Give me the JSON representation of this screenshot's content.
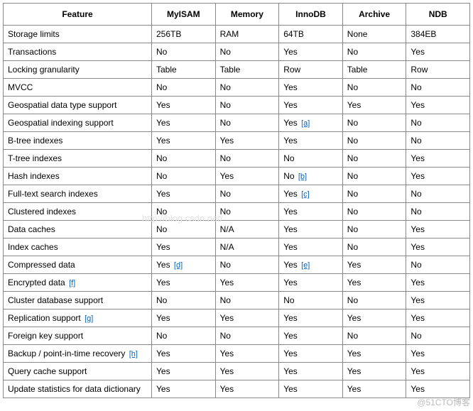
{
  "chart_data": {
    "type": "table",
    "title": "",
    "columns": [
      "Feature",
      "MyISAM",
      "Memory",
      "InnoDB",
      "Archive",
      "NDB"
    ],
    "rows": [
      {
        "feature": "Storage limits",
        "note": null,
        "values": [
          "256TB",
          "RAM",
          "64TB",
          "None",
          "384EB"
        ],
        "cell_notes": [
          null,
          null,
          null,
          null,
          null
        ]
      },
      {
        "feature": "Transactions",
        "note": null,
        "values": [
          "No",
          "No",
          "Yes",
          "No",
          "Yes"
        ],
        "cell_notes": [
          null,
          null,
          null,
          null,
          null
        ]
      },
      {
        "feature": "Locking granularity",
        "note": null,
        "values": [
          "Table",
          "Table",
          "Row",
          "Table",
          "Row"
        ],
        "cell_notes": [
          null,
          null,
          null,
          null,
          null
        ]
      },
      {
        "feature": "MVCC",
        "note": null,
        "values": [
          "No",
          "No",
          "Yes",
          "No",
          "No"
        ],
        "cell_notes": [
          null,
          null,
          null,
          null,
          null
        ]
      },
      {
        "feature": "Geospatial data type support",
        "note": null,
        "values": [
          "Yes",
          "No",
          "Yes",
          "Yes",
          "Yes"
        ],
        "cell_notes": [
          null,
          null,
          null,
          null,
          null
        ]
      },
      {
        "feature": "Geospatial indexing support",
        "note": null,
        "values": [
          "Yes",
          "No",
          "Yes",
          "No",
          "No"
        ],
        "cell_notes": [
          null,
          null,
          "[a]",
          null,
          null
        ]
      },
      {
        "feature": "B-tree indexes",
        "note": null,
        "values": [
          "Yes",
          "Yes",
          "Yes",
          "No",
          "No"
        ],
        "cell_notes": [
          null,
          null,
          null,
          null,
          null
        ]
      },
      {
        "feature": "T-tree indexes",
        "note": null,
        "values": [
          "No",
          "No",
          "No",
          "No",
          "Yes"
        ],
        "cell_notes": [
          null,
          null,
          null,
          null,
          null
        ]
      },
      {
        "feature": "Hash indexes",
        "note": null,
        "values": [
          "No",
          "Yes",
          "No",
          "No",
          "Yes"
        ],
        "cell_notes": [
          null,
          null,
          "[b]",
          null,
          null
        ]
      },
      {
        "feature": "Full-text search indexes",
        "note": null,
        "values": [
          "Yes",
          "No",
          "Yes",
          "No",
          "No"
        ],
        "cell_notes": [
          null,
          null,
          "[c]",
          null,
          null
        ]
      },
      {
        "feature": "Clustered indexes",
        "note": null,
        "values": [
          "No",
          "No",
          "Yes",
          "No",
          "No"
        ],
        "cell_notes": [
          null,
          null,
          null,
          null,
          null
        ]
      },
      {
        "feature": "Data caches",
        "note": null,
        "values": [
          "No",
          "N/A",
          "Yes",
          "No",
          "Yes"
        ],
        "cell_notes": [
          null,
          null,
          null,
          null,
          null
        ]
      },
      {
        "feature": "Index caches",
        "note": null,
        "values": [
          "Yes",
          "N/A",
          "Yes",
          "No",
          "Yes"
        ],
        "cell_notes": [
          null,
          null,
          null,
          null,
          null
        ]
      },
      {
        "feature": "Compressed data",
        "note": null,
        "values": [
          "Yes",
          "No",
          "Yes",
          "Yes",
          "No"
        ],
        "cell_notes": [
          "[d]",
          null,
          "[e]",
          null,
          null
        ]
      },
      {
        "feature": "Encrypted data",
        "note": "[f]",
        "values": [
          "Yes",
          "Yes",
          "Yes",
          "Yes",
          "Yes"
        ],
        "cell_notes": [
          null,
          null,
          null,
          null,
          null
        ]
      },
      {
        "feature": "Cluster database support",
        "note": null,
        "values": [
          "No",
          "No",
          "No",
          "No",
          "Yes"
        ],
        "cell_notes": [
          null,
          null,
          null,
          null,
          null
        ]
      },
      {
        "feature": "Replication support",
        "note": "[g]",
        "values": [
          "Yes",
          "Yes",
          "Yes",
          "Yes",
          "Yes"
        ],
        "cell_notes": [
          null,
          null,
          null,
          null,
          null
        ]
      },
      {
        "feature": "Foreign key support",
        "note": null,
        "values": [
          "No",
          "No",
          "Yes",
          "No",
          "No"
        ],
        "cell_notes": [
          null,
          null,
          null,
          null,
          null
        ]
      },
      {
        "feature": "Backup / point-in-time recovery",
        "note": "[h]",
        "values": [
          "Yes",
          "Yes",
          "Yes",
          "Yes",
          "Yes"
        ],
        "cell_notes": [
          null,
          null,
          null,
          null,
          null
        ]
      },
      {
        "feature": "Query cache support",
        "note": null,
        "values": [
          "Yes",
          "Yes",
          "Yes",
          "Yes",
          "Yes"
        ],
        "cell_notes": [
          null,
          null,
          null,
          null,
          null
        ]
      },
      {
        "feature": "Update statistics for data dictionary",
        "note": null,
        "values": [
          "Yes",
          "Yes",
          "Yes",
          "Yes",
          "Yes"
        ],
        "cell_notes": [
          null,
          null,
          null,
          null,
          null
        ]
      }
    ]
  },
  "watermark_right": "@51CTO博客",
  "watermark_mid": "http://blog.csdn.net/"
}
